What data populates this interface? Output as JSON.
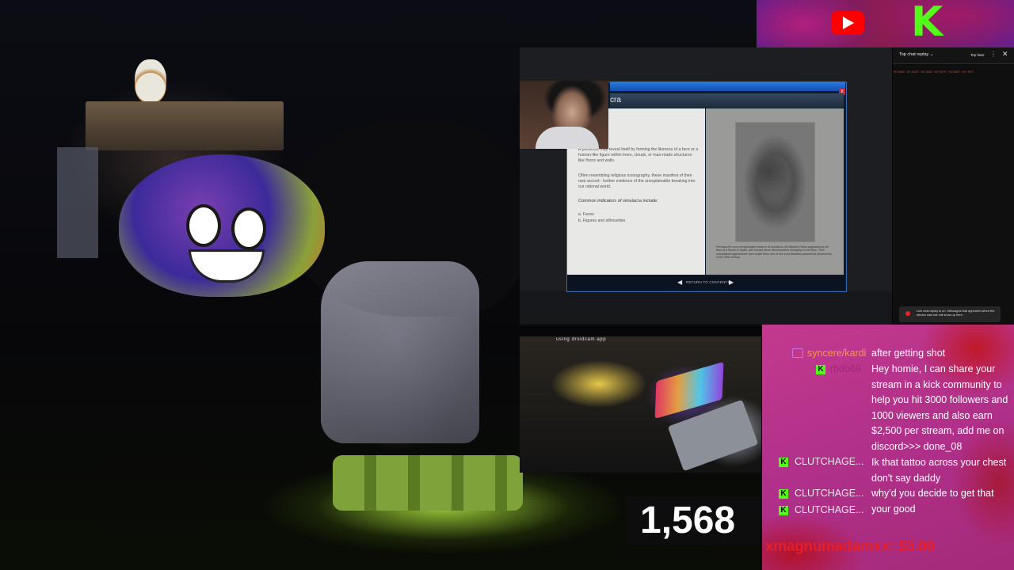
{
  "screen_share": {
    "window_title_fragment": "cra",
    "paragraph_1": "A presence may reveal itself by forming the likeness of a face or a human-like figure within trees, clouds, or man-made structures like floors and walls.",
    "paragraph_2": "Often resembling religious iconography, these manifest of their own accord - further evidence of the unexplainable breaking into our rational world.",
    "indicators_heading": "Common indicators of simulacra include:",
    "indicator_a": "a. Faces",
    "indicator_b": "b. Figures and silhouettes",
    "photo_caption": "Perhaps the most recognizable instance of simulacra, the Bélmez Faces appeared on the floor of a house in Spain, with human faces discolouration emerging on the floor. Their unexplained appearance have made them one of the most debated paranormal phenomena of the 20th century.",
    "nav_prev_icon": "◀",
    "nav_label": "RETURN TO CONTENTS",
    "nav_next_icon": "▶",
    "close_glyph": "x"
  },
  "chat_replay": {
    "title": "Top chat replay ⌄",
    "top_fans": "Top fans",
    "menu_icon": "⋮",
    "close_icon": "✕",
    "red_line": "NO WAR · NO HATE · NO WAR · NO HATE · NO WAR · NO HATE",
    "notice": "Live chat replay is on. Messages that appeared when the stream was live will show up here."
  },
  "phone_cam": {
    "label": "using droidcam.app"
  },
  "viewer_count": "1,568",
  "chat": [
    {
      "name": "syncere/kardi",
      "message": "after getting shot"
    },
    {
      "name": "rbdo69",
      "message": "Hey homie, I can share your stream in a kick community to help you hit 3000 followers and 1000 viewers and also earn $2,500 per stream, add me on discord>>> done_08"
    },
    {
      "name": "CLUTCHAGE...",
      "message": "Ik that tattoo across your chest don't say daddy"
    },
    {
      "name": "CLUTCHAGE...",
      "message": "why'd you decide to get that"
    },
    {
      "name": "CLUTCHAGE...",
      "message": "your good"
    }
  ],
  "donation": "xmagnumadamxx: $5.00",
  "badges": {
    "kick": "K"
  },
  "colors": {
    "kick_green": "#53fc18",
    "youtube_red": "#ff0000",
    "overlay_pink": "#b0308a",
    "donation_red": "#e51e2a"
  }
}
